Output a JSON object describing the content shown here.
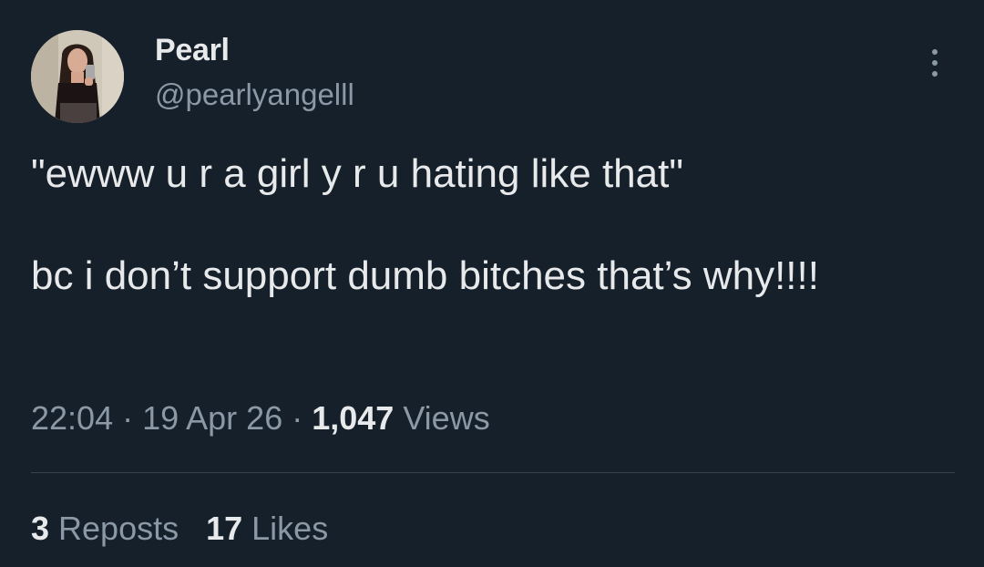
{
  "author": {
    "display_name": "Pearl",
    "handle": "@pearlyangelll"
  },
  "tweet": {
    "text": "\"ewww u r a girl y r u hating like that\"\n\nbc i don’t support dumb bitches that’s why!!!!"
  },
  "meta": {
    "time": "22:04",
    "separator": " · ",
    "date": "19 Apr 26",
    "views_count": "1,047",
    "views_label": " Views"
  },
  "stats": {
    "reposts_count": "3",
    "reposts_label": " Reposts",
    "likes_count": "17",
    "likes_label": " Likes"
  },
  "icons": {
    "more": "more-options-icon"
  },
  "colors": {
    "background": "#15202b",
    "primary_text": "#e7e9ea",
    "secondary_text": "#8b98a5",
    "divider": "#38444d"
  }
}
